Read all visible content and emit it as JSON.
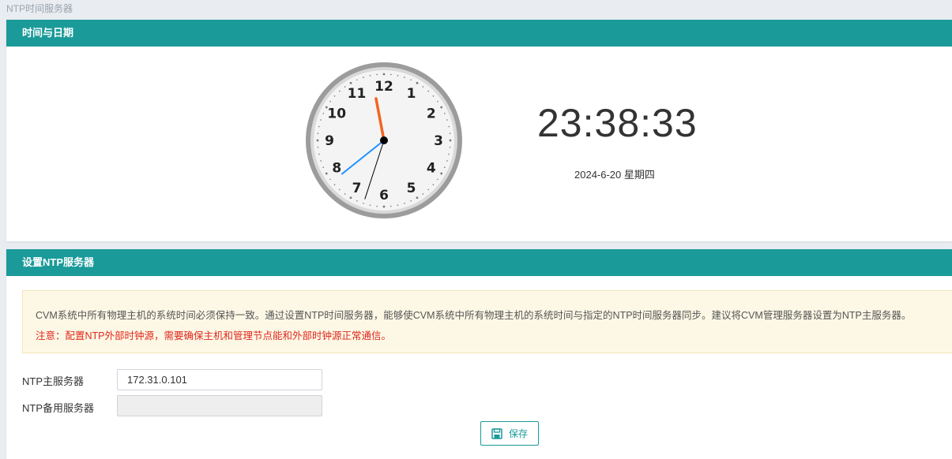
{
  "breadcrumb": "NTP时间服务器",
  "time_panel": {
    "title": "时间与日期",
    "clock": {
      "numerals": [
        "12",
        "1",
        "2",
        "3",
        "4",
        "5",
        "6",
        "7",
        "8",
        "9",
        "10",
        "11"
      ],
      "hour": 23,
      "minute": 38,
      "second": 33,
      "hour_hand_color": "#f26522",
      "minute_hand_color": "#1e90ff",
      "second_hand_color": "#000000"
    },
    "digital_time": "23:38:33",
    "date": "2024-6-20 星期四"
  },
  "ntp_panel": {
    "title": "设置NTP服务器",
    "notice": {
      "line1": "CVM系统中所有物理主机的系统时间必须保持一致。通过设置NTP时间服务器，能够使CVM系统中所有物理主机的系统时间与指定的NTP时间服务器同步。建议将CVM管理服务器设置为NTP主服务器。",
      "line2": "注意：配置NTP外部时钟源，需要确保主机和管理节点能和外部时钟源正常通信。"
    },
    "primary": {
      "label": "NTP主服务器",
      "value": "172.31.0.101"
    },
    "backup": {
      "label": "NTP备用服务器",
      "value": ""
    },
    "save_label": "保存",
    "save_icon": "save-icon"
  },
  "colors": {
    "accent": "#1a9a99",
    "warning_text": "#e0281d",
    "notice_bg": "#fdf8e6"
  }
}
